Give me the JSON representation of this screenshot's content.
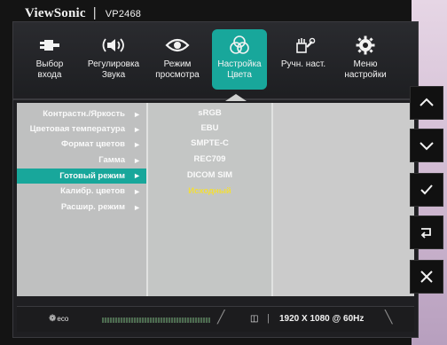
{
  "brand": {
    "name": "ViewSonic",
    "separator": "|",
    "model": "VP2468"
  },
  "tabs": [
    {
      "icon": "input-plug-icon",
      "label_line1": "Выбор",
      "label_line2": "входа"
    },
    {
      "icon": "speaker-icon",
      "label_line1": "Регулировка",
      "label_line2": "Звука"
    },
    {
      "icon": "eye-icon",
      "label_line1": "Режим",
      "label_line2": "просмотра"
    },
    {
      "icon": "color-circles-icon",
      "label_line1": "Настройка",
      "label_line2": "Цвета",
      "active": true
    },
    {
      "icon": "tools-icon",
      "label_line1": "Ручн. наст.",
      "label_line2": ""
    },
    {
      "icon": "gear-icon",
      "label_line1": "Меню",
      "label_line2": "настройки"
    }
  ],
  "menu": {
    "items": [
      {
        "label": "Контрастн./Яркость",
        "arrow": "►"
      },
      {
        "label": "Цветовая температура",
        "arrow": "►"
      },
      {
        "label": "Формат цветов",
        "arrow": "►"
      },
      {
        "label": "Гамма",
        "arrow": "►"
      },
      {
        "label": "Готовый режим",
        "arrow": "►",
        "selected": true
      },
      {
        "label": "Калибр. цветов",
        "arrow": "►"
      },
      {
        "label": "Расшир. режим",
        "arrow": "►"
      }
    ]
  },
  "options": [
    {
      "label": "sRGB"
    },
    {
      "label": "EBU"
    },
    {
      "label": "SMPTE-C"
    },
    {
      "label": "REC709"
    },
    {
      "label": "DICOM SIM"
    },
    {
      "label": "Исходный",
      "current": true
    }
  ],
  "status": {
    "eco_label": "eco",
    "resolution": "1920 X 1080 @ 60Hz"
  },
  "side_keys": [
    {
      "icon": "chevron-up-icon"
    },
    {
      "icon": "chevron-down-icon"
    },
    {
      "icon": "check-icon"
    },
    {
      "icon": "return-icon"
    },
    {
      "icon": "close-icon"
    }
  ],
  "colors": {
    "accent": "#18a79b",
    "current_option": "#f2de3a",
    "panel": "#cfd0cf"
  }
}
